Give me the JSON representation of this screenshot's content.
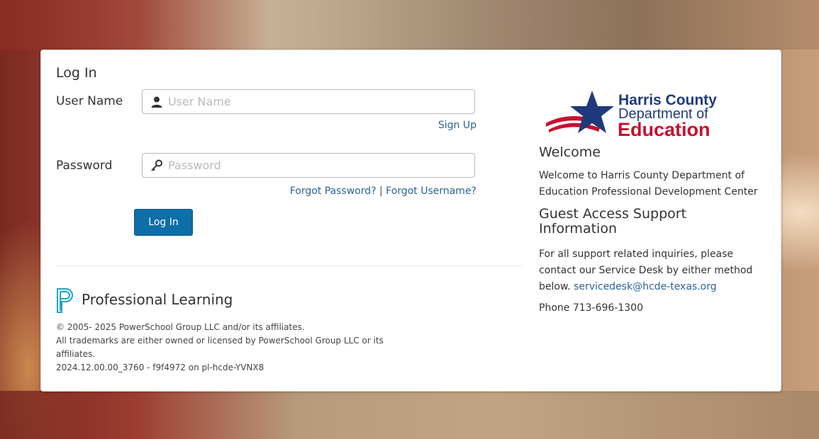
{
  "login": {
    "title": "Log In",
    "username_label": "User Name",
    "username_placeholder": "User Name",
    "signup_link": "Sign Up",
    "password_label": "Password",
    "password_placeholder": "Password",
    "forgot_password_link": "Forgot Password?",
    "separator": "|",
    "forgot_username_link": "Forgot Username?",
    "submit_label": "Log In"
  },
  "branding": {
    "product_name": "Professional Learning",
    "logo_icon": "powerschool-p-icon",
    "org_logo": {
      "line1": "Harris County",
      "line2": "Department of",
      "line3": "Education",
      "navy": "#1f3a7a",
      "red": "#c8102e"
    }
  },
  "footer": {
    "copyright": "© 2005- 2025 PowerSchool Group LLC and/or its affiliates.",
    "trademarks": "All trademarks are either owned or licensed by PowerSchool Group LLC or its affiliates.",
    "version": "2024.12.00.00_3760 - f9f4972 on pl-hcde-YVNX8"
  },
  "info": {
    "welcome_heading": "Welcome",
    "welcome_text": "Welcome to Harris County Department of Education Professional Development Center",
    "guest_heading": "Guest Access Support Information",
    "support_text": "For all support related inquiries, please contact our Service Desk by either method below.",
    "support_email": "servicedesk@hcde-texas.org",
    "phone": "Phone 713-696-1300"
  },
  "colors": {
    "primary_button": "#0e6ea8",
    "link": "#2a6496",
    "logo_teal": "#1aa6c8"
  }
}
